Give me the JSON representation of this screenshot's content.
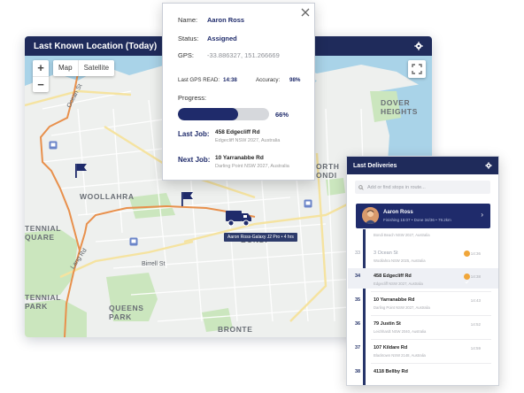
{
  "map": {
    "title": "Last Known Location (Today)",
    "zoom_in": "+",
    "zoom_out": "−",
    "map_type": [
      "Map",
      "Satellite"
    ],
    "labels": {
      "dover_heights": "DOVER\nHEIGHTS",
      "woollahra": "WOOLLAHRA",
      "centennial_square": "TENNIAL\nQUARE",
      "centennial_park": "TENNIAL\nPARK",
      "queens_park": "QUEENS\nPARK",
      "bondi": "BONDI",
      "north_bondi": "ORTH\nONDI",
      "bronte": "BRONTE",
      "birrell_st": "Birrell St",
      "ocean_st": "Ocean St",
      "lang_rd": "Lang Rd"
    },
    "vehicle_tag": "Aaron Ross-Galaxy J2 Pro • 4 hrs"
  },
  "popup": {
    "name_label": "Name:",
    "name_value": "Aaron Ross",
    "status_label": "Status:",
    "status_value": "Assigned",
    "gps_label": "GPS:",
    "gps_value": "-33.886327, 151.266669",
    "last_gps_label": "Last GPS READ:",
    "last_gps_value": "14:38",
    "accuracy_label": "Accuracy:",
    "accuracy_value": "98%",
    "progress_label": "Progress:",
    "progress_value": "66%",
    "progress_fraction": 0.66,
    "last_job_label": "Last Job:",
    "last_job_addr": "458 Edgecliff Rd",
    "last_job_sub": "Edgecliff NSW 2027, Australia",
    "next_job_label": "Next Job:",
    "next_job_addr": "10 Yarranabbe Rd",
    "next_job_sub": "Darling Point NSW 2027, Australia"
  },
  "panel": {
    "title": "Last Deliveries",
    "search_placeholder": "Add or find stops in route...",
    "driver": {
      "name": "Aaron Ross",
      "sub": "Finishing 15:07  •  Done 34/36  •  79.2km"
    },
    "partial_row": "Bondi Beach NSW 2027, Australia",
    "stops": [
      {
        "num": "33",
        "addr": "3 Ocean St",
        "sub": "Woollahra NSW 2025, Australia",
        "time": "14:36",
        "state": "done"
      },
      {
        "num": "34",
        "addr": "458 Edgecliff Rd",
        "sub": "Edgecliff NSW 2027, Australia",
        "time": "14:38",
        "state": "active"
      },
      {
        "num": "35",
        "addr": "10 Yarranabbe Rd",
        "sub": "Darling Point NSW 2027, Australia",
        "time": "14:43",
        "state": "pending"
      },
      {
        "num": "36",
        "addr": "79 Justin St",
        "sub": "Leichhardt NSW 2040, Australia",
        "time": "14:52",
        "state": "pending"
      },
      {
        "num": "37",
        "addr": "107 Kildare Rd",
        "sub": "Blacktown NSW 2148, Australia",
        "time": "14:59",
        "state": "pending"
      },
      {
        "num": "38",
        "addr": "4118 Bellby Rd",
        "sub": "",
        "time": "",
        "state": "pending"
      }
    ]
  },
  "colors": {
    "navy": "#1f2b5b",
    "accent": "#1f2b6b",
    "route": "#e8904c",
    "check": "#f0a63a",
    "water": "#a9d3e8",
    "park": "#cbe6be"
  }
}
